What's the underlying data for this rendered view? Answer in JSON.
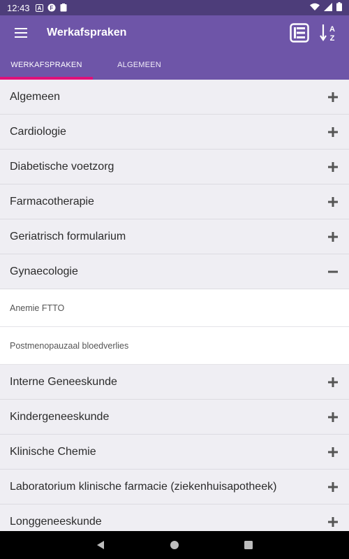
{
  "status_bar": {
    "time": "12:43",
    "left_icons": [
      "a-notification-icon",
      "f-notification-icon",
      "clipboard-icon"
    ],
    "right_icons": [
      "wifi-icon",
      "signal-icon",
      "battery-icon"
    ]
  },
  "app_bar": {
    "title": "Werkafspraken",
    "actions": [
      "list-view-icon",
      "sort-az-icon"
    ],
    "background": "#6e55a8"
  },
  "tabs": [
    {
      "label": "WERKAFSPRAKEN",
      "active": true
    },
    {
      "label": "ALGEMEEN",
      "active": false
    }
  ],
  "accent_color": "#e0107a",
  "categories": [
    {
      "label": "Algemeen",
      "expanded": false
    },
    {
      "label": "Cardiologie",
      "expanded": false
    },
    {
      "label": "Diabetische voetzorg",
      "expanded": false
    },
    {
      "label": "Farmacotherapie",
      "expanded": false
    },
    {
      "label": "Geriatrisch formularium",
      "expanded": false
    },
    {
      "label": "Gynaecologie",
      "expanded": true,
      "children": [
        "Anemie FTTO",
        "Postmenopauzaal bloedverlies"
      ]
    },
    {
      "label": "Interne Geneeskunde",
      "expanded": false
    },
    {
      "label": "Kindergeneeskunde",
      "expanded": false
    },
    {
      "label": "Klinische Chemie",
      "expanded": false
    },
    {
      "label": "Laboratorium klinische farmacie (ziekenhuisapotheek)",
      "expanded": false
    },
    {
      "label": "Longgeneeskunde",
      "expanded": false
    }
  ],
  "nav_bar": [
    "back-icon",
    "home-icon",
    "recents-icon"
  ]
}
